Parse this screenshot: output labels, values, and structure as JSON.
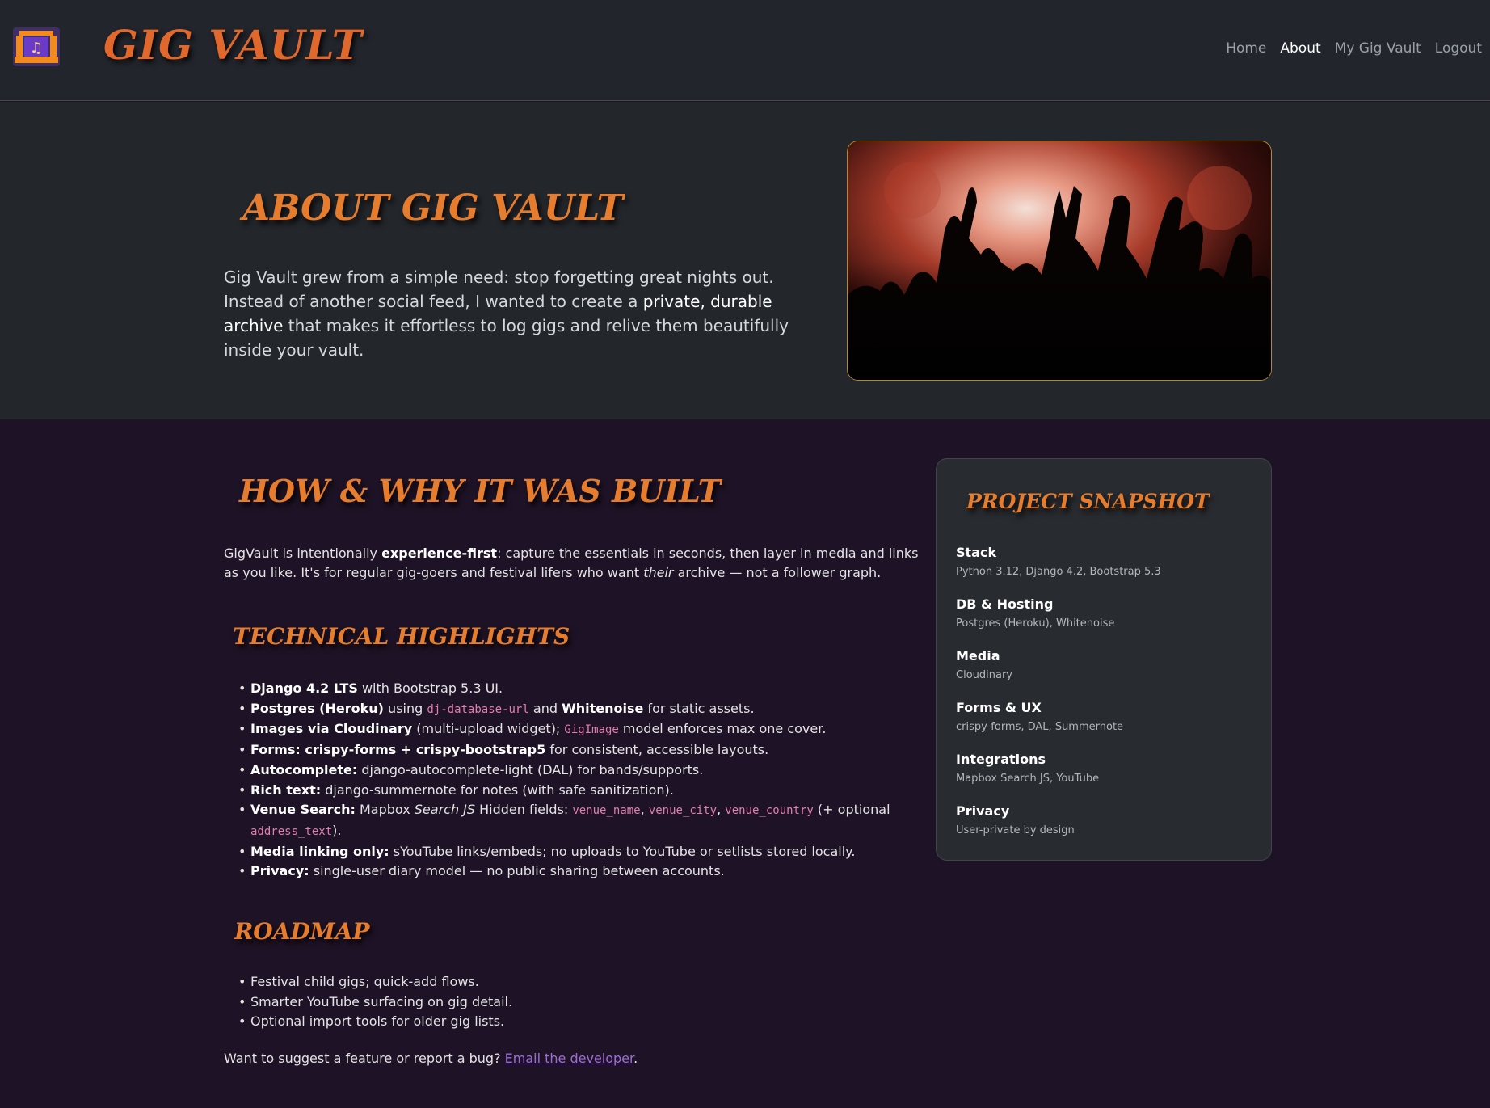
{
  "navbar": {
    "brand": "GIG VAULT",
    "logo_icon": "venue-stage-music-note-icon",
    "links": [
      "Home",
      "About",
      "My Gig Vault",
      "Logout"
    ],
    "active_link": "About"
  },
  "hero": {
    "title": "ABOUT GIG VAULT",
    "text_before": "Gig Vault grew from a simple need: stop forgetting great nights out. Instead of another social feed, I wanted to create a ",
    "text_strong": "private, durable archive",
    "text_after": " that makes it effortless to log gigs and relive them beautifully inside your vault.",
    "image": "concert-crowd-hands-raised-photo"
  },
  "main": {
    "title": "HOW & WHY IT WAS BUILT",
    "intro_1": "GigVault is intentionally ",
    "intro_strong": "experience-first",
    "intro_2": ": capture the essentials in seconds, then layer in media and links as you like. It's for regular gig-goers and festival lifers who want ",
    "intro_em": "their",
    "intro_3": " archive — not a follower graph.",
    "tech_title": "TECHNICAL HIGHLIGHTS",
    "tech": {
      "t1_b": "Django 4.2 LTS",
      "t1_r": " with Bootstrap 5.3 UI.",
      "t2_b": "Postgres (Heroku)",
      "t2_r1": " using ",
      "t2_c": "dj-database-url",
      "t2_r2": " and ",
      "t2_b2": "Whitenoise",
      "t2_r3": " for static assets.",
      "t3_b": "Images via Cloudinary",
      "t3_r1": " (multi-upload widget); ",
      "t3_c": "GigImage",
      "t3_r2": " model enforces max one cover.",
      "t4_b": "Forms: crispy-forms + crispy-bootstrap5",
      "t4_r": " for consistent, accessible layouts.",
      "t5_b": "Autocomplete:",
      "t5_r": " django-autocomplete-light (DAL) for bands/supports.",
      "t6_b": "Rich text:",
      "t6_r": " django-summernote for notes (with safe sanitization).",
      "t7_b": "Venue Search:",
      "t7_r1": " Mapbox ",
      "t7_em": "Search JS",
      "t7_r2": " Hidden fields: ",
      "t7_c1": "venue_name",
      "t7_c2": "venue_city",
      "t7_c3": "venue_country",
      "t7_r3": " (+ optional ",
      "t7_c4": "address_text",
      "t7_r4": ").",
      "t8_b": "Media linking only:",
      "t8_r": " sYouTube links/embeds; no uploads to YouTube or setlists stored locally.",
      "t9_b": "Privacy:",
      "t9_r": " single-user diary model — no public sharing between accounts."
    },
    "roadmap_title": "ROADMAP",
    "roadmap": [
      "Festival child gigs; quick-add flows.",
      "Smarter YouTube surfacing on gig detail.",
      "Optional import tools for older gig lists."
    ],
    "footer_text": "Want to suggest a feature or report a bug? ",
    "footer_link": "Email the developer",
    "footer_end": "."
  },
  "snapshot": {
    "title": "PROJECT SNAPSHOT",
    "items": [
      {
        "label": "Stack",
        "value": "Python 3.12, Django 4.2, Bootstrap 5.3"
      },
      {
        "label": "DB & Hosting",
        "value": "Postgres (Heroku), Whitenoise"
      },
      {
        "label": "Media",
        "value": "Cloudinary"
      },
      {
        "label": "Forms & UX",
        "value": "crispy-forms, DAL, Summernote"
      },
      {
        "label": "Integrations",
        "value": "Mapbox Search JS, YouTube"
      },
      {
        "label": "Privacy",
        "value": "User-private by design"
      }
    ]
  },
  "colors": {
    "accent_orange": "#e67d2e",
    "link_purple": "#9d6bd8",
    "code_pink": "#e57cae",
    "image_border_gold": "#b88a22"
  }
}
